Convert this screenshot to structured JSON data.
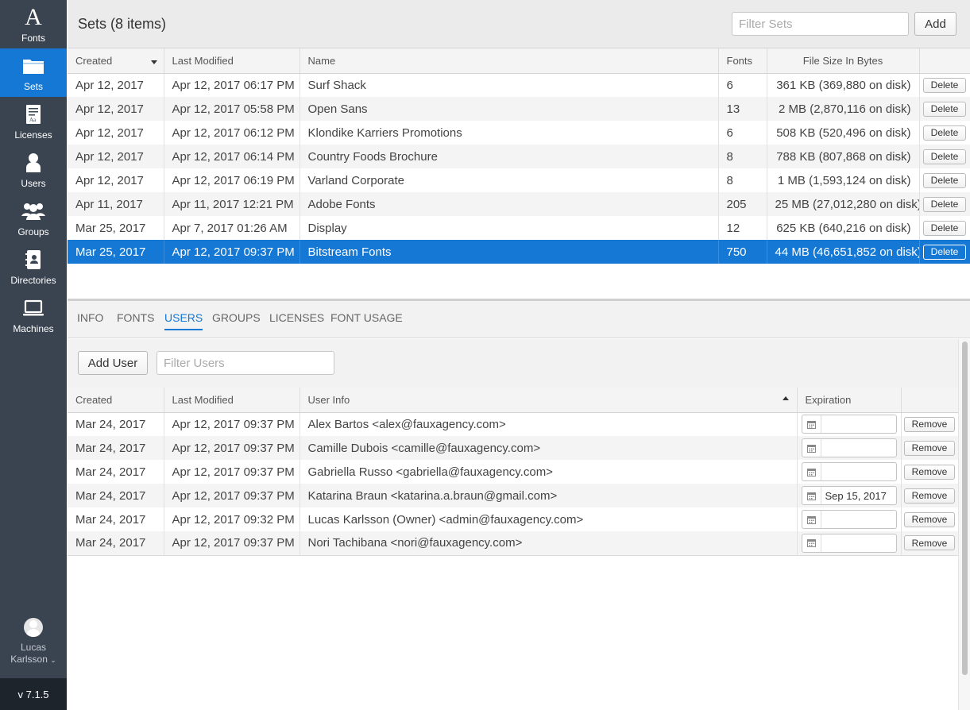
{
  "sidebar": {
    "items": [
      {
        "label": "Fonts",
        "icon": "letter-a-icon",
        "active": false
      },
      {
        "label": "Sets",
        "icon": "folder-icon",
        "active": true
      },
      {
        "label": "Licenses",
        "icon": "license-document-icon",
        "active": false
      },
      {
        "label": "Users",
        "icon": "user-icon",
        "active": false
      },
      {
        "label": "Groups",
        "icon": "group-icon",
        "active": false
      },
      {
        "label": "Directories",
        "icon": "address-book-icon",
        "active": false
      },
      {
        "label": "Machines",
        "icon": "laptop-icon",
        "active": false
      }
    ],
    "user": {
      "name_line1": "Lucas",
      "name_line2": "Karlsson"
    },
    "version": "v 7.1.5"
  },
  "header": {
    "title": "Sets (8 items)",
    "filter_placeholder": "Filter Sets",
    "add_label": "Add"
  },
  "sets_table": {
    "columns": [
      "Created",
      "Last Modified",
      "Name",
      "Fonts",
      "File Size In Bytes",
      ""
    ],
    "delete_label": "Delete",
    "rows": [
      {
        "created": "Apr 12, 2017",
        "modified": "Apr 12, 2017 06:17 PM",
        "name": "Surf Shack",
        "fonts": "6",
        "size": "361 KB (369,880 on disk)"
      },
      {
        "created": "Apr 12, 2017",
        "modified": "Apr 12, 2017 05:58 PM",
        "name": "Open Sans",
        "fonts": "13",
        "size": "2 MB (2,870,116 on disk)"
      },
      {
        "created": "Apr 12, 2017",
        "modified": "Apr 12, 2017 06:12 PM",
        "name": "Klondike Karriers Promotions",
        "fonts": "6",
        "size": "508 KB (520,496 on disk)"
      },
      {
        "created": "Apr 12, 2017",
        "modified": "Apr 12, 2017 06:14 PM",
        "name": "Country Foods Brochure",
        "fonts": "8",
        "size": "788 KB (807,868 on disk)"
      },
      {
        "created": "Apr 12, 2017",
        "modified": "Apr 12, 2017 06:19 PM",
        "name": "Varland Corporate",
        "fonts": "8",
        "size": "1 MB (1,593,124 on disk)"
      },
      {
        "created": "Apr 11, 2017",
        "modified": "Apr 11, 2017 12:21 PM",
        "name": "Adobe Fonts",
        "fonts": "205",
        "size": "25 MB (27,012,280 on disk)"
      },
      {
        "created": "Mar 25, 2017",
        "modified": "Apr 7, 2017 01:26 AM",
        "name": "Display",
        "fonts": "12",
        "size": "625 KB (640,216 on disk)"
      },
      {
        "created": "Mar 25, 2017",
        "modified": "Apr 12, 2017 09:37 PM",
        "name": "Bitstream Fonts",
        "fonts": "750",
        "size": "44 MB (46,651,852 on disk)",
        "selected": true
      }
    ]
  },
  "tabs": [
    {
      "label": "INFO",
      "active": false
    },
    {
      "label": "FONTS",
      "active": false
    },
    {
      "label": "USERS",
      "active": true
    },
    {
      "label": "GROUPS",
      "active": false
    },
    {
      "label": "LICENSES",
      "active": false
    },
    {
      "label": "FONT USAGE",
      "active": false
    }
  ],
  "users_panel": {
    "add_user_label": "Add User",
    "filter_placeholder": "Filter Users",
    "columns": [
      "Created",
      "Last Modified",
      "User Info",
      "Expiration",
      ""
    ],
    "remove_label": "Remove",
    "rows": [
      {
        "created": "Mar 24, 2017",
        "modified": "Apr 12, 2017 09:37 PM",
        "info": "Alex Bartos <alex@fauxagency.com>",
        "expiration": ""
      },
      {
        "created": "Mar 24, 2017",
        "modified": "Apr 12, 2017 09:37 PM",
        "info": "Camille Dubois <camille@fauxagency.com>",
        "expiration": ""
      },
      {
        "created": "Mar 24, 2017",
        "modified": "Apr 12, 2017 09:37 PM",
        "info": "Gabriella Russo <gabriella@fauxagency.com>",
        "expiration": ""
      },
      {
        "created": "Mar 24, 2017",
        "modified": "Apr 12, 2017 09:37 PM",
        "info": "Katarina Braun <katarina.a.braun@gmail.com>",
        "expiration": "Sep 15, 2017"
      },
      {
        "created": "Mar 24, 2017",
        "modified": "Apr 12, 2017 09:32 PM",
        "info": "Lucas Karlsson (Owner) <admin@fauxagency.com>",
        "expiration": ""
      },
      {
        "created": "Mar 24, 2017",
        "modified": "Apr 12, 2017 09:37 PM",
        "info": "Nori Tachibana <nori@fauxagency.com>",
        "expiration": ""
      }
    ]
  },
  "colors": {
    "sidebar_bg": "#3a4350",
    "accent": "#1478d4",
    "version_bar_bg": "#1e242c"
  }
}
